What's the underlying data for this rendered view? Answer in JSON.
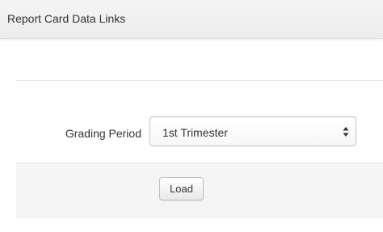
{
  "panel": {
    "title": "Report Card Data Links"
  },
  "form": {
    "grading_period": {
      "label": "Grading Period",
      "selected_value": "1st Trimester"
    },
    "load_button_label": "Load"
  },
  "icons": {
    "select_arrows": "updown-arrows-icon"
  }
}
